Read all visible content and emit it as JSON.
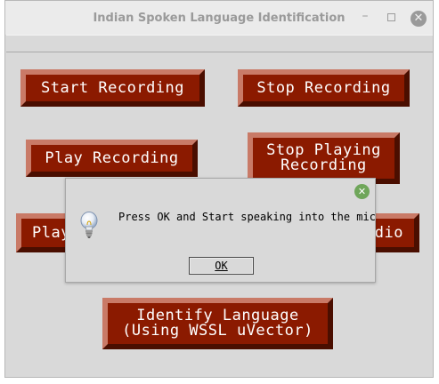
{
  "window": {
    "title": "Indian Spoken Language Identification",
    "controls": {
      "minimize": "–",
      "close": "✕"
    }
  },
  "buttons": {
    "start_recording": "Start Recording",
    "stop_recording": "Stop Recording",
    "play_recording": "Play Recording",
    "stop_playing_recording": "Stop Playing\nRecording",
    "play_partial": "Play",
    "audio_partial": "dio",
    "identify_language": "Identify Language\n(Using WSSL uVector)"
  },
  "dialog": {
    "message": "Press OK and Start speaking into the mic",
    "ok_label": "OK",
    "close_glyph": "✕",
    "icon": "lightbulb-icon"
  },
  "colors": {
    "button_face": "#8b1a00",
    "button_highlight": "#c97a67",
    "button_shadow": "#4a0e00",
    "window_bg": "#d9d9d9",
    "dialog_close": "#6fa65a"
  }
}
